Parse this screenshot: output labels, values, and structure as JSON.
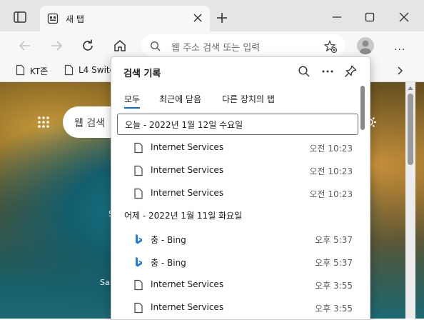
{
  "tab": {
    "title": "새 탭"
  },
  "address": {
    "placeholder": "웹 주소 검색 또는 입력"
  },
  "favorites": [
    {
      "label": "KT존"
    },
    {
      "label": "L4 Switc"
    }
  ],
  "page": {
    "search_placeholder": "웹 검색",
    "side_text_1": "S",
    "side_text_2": "Sa"
  },
  "history": {
    "title": "검색 기록",
    "tabs": [
      {
        "label": "모두",
        "active": true
      },
      {
        "label": "최근에 닫음",
        "active": false
      },
      {
        "label": "다른 장치의 탭",
        "active": false
      }
    ],
    "groups": [
      {
        "header": "오늘 - 2022년 1월 12일 수요일",
        "items": [
          {
            "title": "Internet Services",
            "time": "오전 10:23",
            "icon": "page-icon"
          },
          {
            "title": "Internet Services",
            "time": "오전 10:23",
            "icon": "page-icon"
          },
          {
            "title": "Internet Services",
            "time": "오전 10:23",
            "icon": "page-icon"
          }
        ]
      },
      {
        "header": "어제 - 2022년 1월 11일 화요일",
        "items": [
          {
            "title": "충 - Bing",
            "time": "오후 5:37",
            "icon": "bing-icon"
          },
          {
            "title": "충 - Bing",
            "time": "오후 5:37",
            "icon": "bing-icon"
          },
          {
            "title": "Internet Services",
            "time": "오후 3:55",
            "icon": "page-icon"
          },
          {
            "title": "Internet Services",
            "time": "오후 3:55",
            "icon": "page-icon"
          }
        ]
      }
    ]
  },
  "colors": {
    "accent": "#0f6cbd",
    "bing": "#1b7ee3",
    "titlebar": "#e5e5e5",
    "toolbar": "#f7f7f7"
  }
}
